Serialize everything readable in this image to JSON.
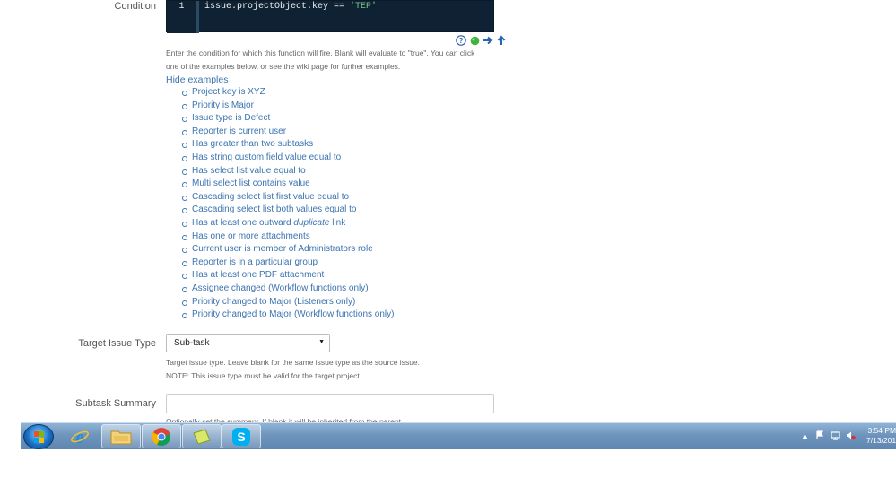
{
  "condition": {
    "label": "Condition",
    "line_number": "1",
    "code_plain": "issue.projectObject.key == ",
    "code_string": "'TEP'",
    "help_line1": "Enter the condition for which this function will fire. Blank will evaluate to \"true\". You can click",
    "help_line2": "one of the examples below, or see the wiki page for further examples.",
    "hide_examples": "Hide examples",
    "examples": [
      "Project key is XYZ",
      "Priority is Major",
      "Issue type is Defect",
      "Reporter is current user",
      "Has greater than two subtasks",
      "Has string custom field value equal to",
      "Has select list value equal to",
      "Multi select list contains value",
      "Cascading select list first value equal to",
      "Cascading select list both values equal to",
      "Has at least one outward ",
      "Has one or more attachments",
      "Current user is member of Administrators role",
      "Reporter is in a particular group",
      "Has at least one PDF attachment",
      "Assignee changed (Workflow functions only)",
      "Priority changed to Major (Listeners only)",
      "Priority changed to Major (Workflow functions only)"
    ],
    "example_duplicate_em": "duplicate",
    "example_duplicate_tail": " link"
  },
  "target_issue_type": {
    "label": "Target Issue Type",
    "value": "Sub-task",
    "help_line1": "Target issue type. Leave blank for the same issue type as the source issue.",
    "help_line2": "NOTE: This issue type must be valid for the target project"
  },
  "subtask_summary": {
    "label": "Subtask Summary",
    "value": "",
    "help_cut": "Optionally set the summary. If blank it will be inherited from the parent"
  },
  "taskbar": {
    "time": "3:54 PM",
    "date": "7/13/201"
  },
  "colors": {
    "link": "#3b73af",
    "editor_bg": "#0e2233",
    "string": "#7ec38a"
  }
}
